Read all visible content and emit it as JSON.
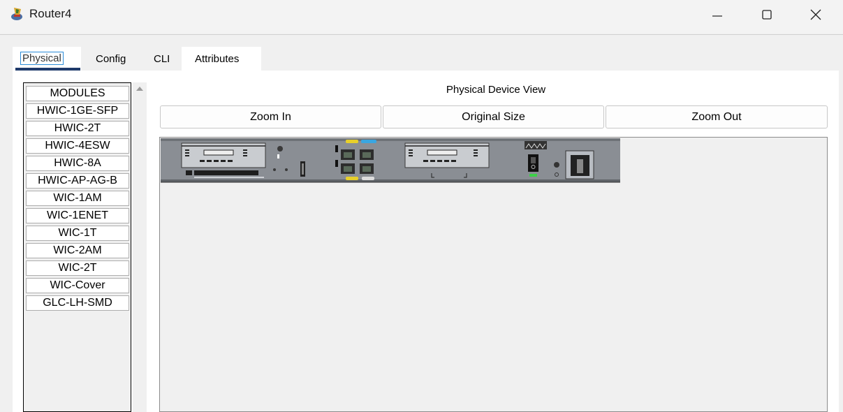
{
  "window": {
    "title": "Router4",
    "icon": "router-app-icon",
    "controls": [
      "minimize-icon",
      "maximize-icon",
      "close-icon"
    ]
  },
  "tabs": [
    {
      "label": "Physical",
      "active": true
    },
    {
      "label": "Config",
      "active": false
    },
    {
      "label": "CLI",
      "active": false
    },
    {
      "label": "Attributes",
      "active": false
    }
  ],
  "modules": {
    "items": [
      "MODULES",
      "HWIC-1GE-SFP",
      "HWIC-2T",
      "HWIC-4ESW",
      "HWIC-8A",
      "HWIC-AP-AG-B",
      "WIC-1AM",
      "WIC-1ENET",
      "WIC-1T",
      "WIC-2AM",
      "WIC-2T",
      "WIC-Cover",
      "GLC-LH-SMD"
    ]
  },
  "device_view": {
    "title": "Physical Device View",
    "zoom_in": "Zoom In",
    "original_size": "Original Size",
    "zoom_out": "Zoom Out"
  },
  "colors": {
    "tab_underline": "#1f3a6b",
    "focus_outline": "#2a8bd8",
    "device_body": "#8a8e94"
  }
}
